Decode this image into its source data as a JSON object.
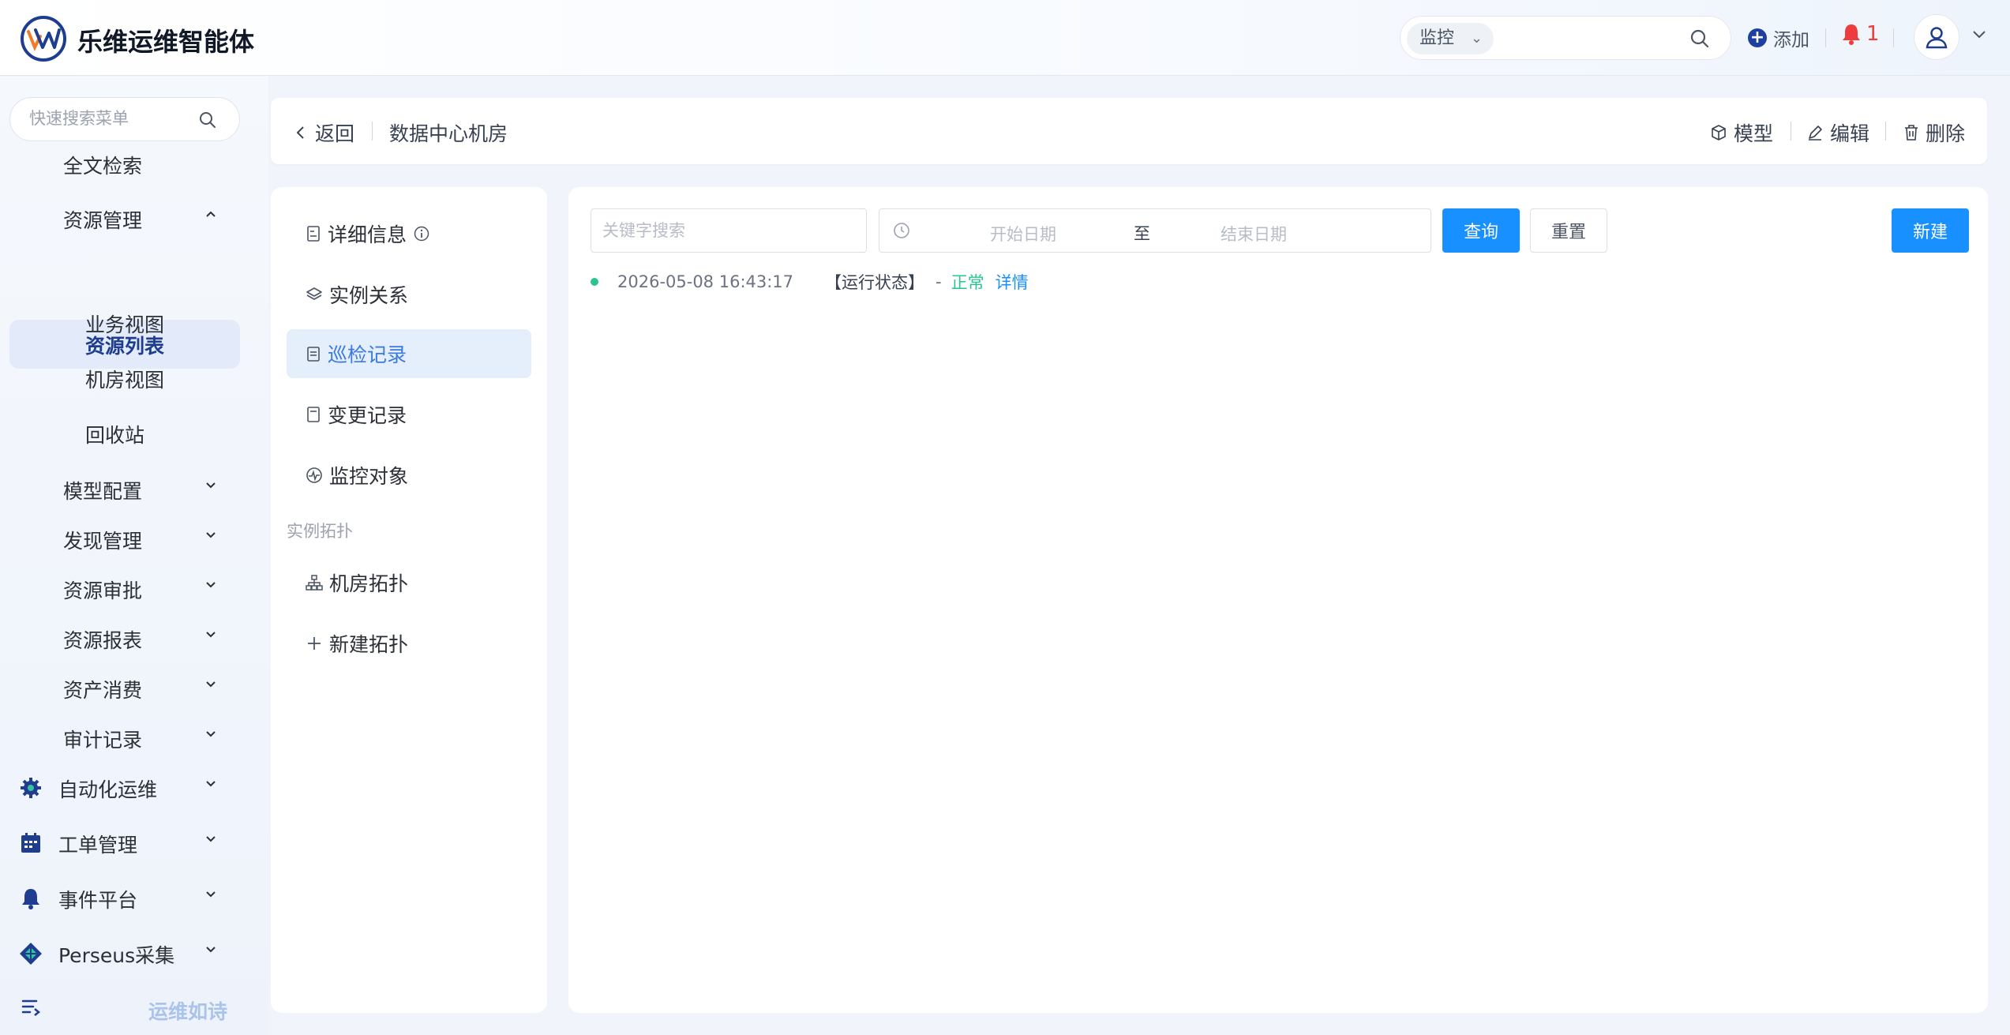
{
  "app": {
    "title": "乐维运维智能体"
  },
  "header": {
    "search_scope": "监控",
    "add_label": "添加",
    "alarm_count": "1"
  },
  "sidebar": {
    "search_placeholder": "快速搜索菜单",
    "items": [
      {
        "label": "全文检索"
      },
      {
        "label": "资源管理"
      },
      {
        "label": "资源列表"
      },
      {
        "label": "业务视图"
      },
      {
        "label": "机房视图"
      },
      {
        "label": "回收站"
      },
      {
        "label": "模型配置"
      },
      {
        "label": "发现管理"
      },
      {
        "label": "资源审批"
      },
      {
        "label": "资源报表"
      },
      {
        "label": "资产消费"
      },
      {
        "label": "审计记录"
      }
    ],
    "top_sections": [
      {
        "label": "自动化运维",
        "icon": "gear-robot-icon"
      },
      {
        "label": "工单管理",
        "icon": "calendar-icon"
      },
      {
        "label": "事件平台",
        "icon": "bell-icon"
      },
      {
        "label": "Perseus采集",
        "icon": "diamond-grid-icon"
      }
    ],
    "bottom_label": "运维如诗"
  },
  "breadcrumb": {
    "back_label": "返回",
    "title": "数据中心机房",
    "actions": {
      "model": "模型",
      "edit": "编辑",
      "delete": "删除"
    }
  },
  "detail_nav": {
    "items": [
      {
        "label": "详细信息",
        "icon": "doc-icon"
      },
      {
        "label": "实例关系",
        "icon": "layers-icon"
      },
      {
        "label": "巡检记录",
        "icon": "clipboard-icon"
      },
      {
        "label": "变更记录",
        "icon": "file-icon"
      },
      {
        "label": "监控对象",
        "icon": "pulse-icon"
      }
    ],
    "group_label": "实例拓扑",
    "topo_items": [
      {
        "label": "机房拓扑",
        "icon": "topology-icon"
      },
      {
        "label": "新建拓扑",
        "icon": "plus-icon"
      }
    ]
  },
  "filter": {
    "keyword_placeholder": "关键字搜索",
    "start_placeholder": "开始日期",
    "range_sep": "至",
    "end_placeholder": "结束日期",
    "query": "查询",
    "reset": "重置",
    "create": "新建"
  },
  "records": [
    {
      "time": "2026-05-08 16:43:17",
      "tag": "【运行状态】",
      "dash": "-",
      "status": "正常",
      "link": "详情"
    }
  ],
  "colors": {
    "primary": "#1890ff",
    "brand": "#1e3d8f",
    "ok": "#2bc48f",
    "alarm": "#ef3b3b"
  }
}
